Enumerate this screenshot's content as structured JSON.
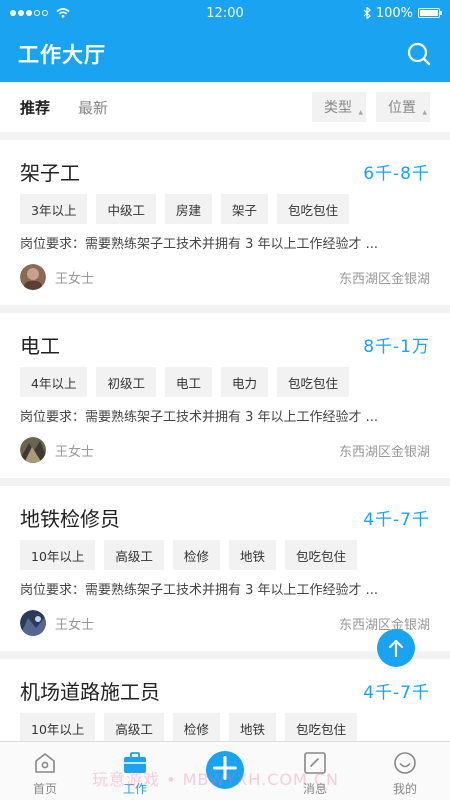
{
  "status_bar": {
    "time": "12:00",
    "battery": "100%"
  },
  "header": {
    "title": "工作大厅"
  },
  "filter_bar": {
    "tabs": [
      {
        "label": "推荐"
      },
      {
        "label": "最新"
      }
    ],
    "filters": [
      {
        "label": "类型"
      },
      {
        "label": "位置"
      }
    ]
  },
  "jobs": [
    {
      "title": "架子工",
      "salary": "6千-8千",
      "tags": [
        "3年以上",
        "中级工",
        "房建",
        "架子",
        "包吃包住"
      ],
      "requirement": "岗位要求：需要熟练架子工技术并拥有 3 年以上工作经验才 ...",
      "poster": "王女士",
      "location": "东西湖区金银湖"
    },
    {
      "title": "电工",
      "salary": "8千-1万",
      "tags": [
        "4年以上",
        "初级工",
        "电工",
        "电力",
        "包吃包住"
      ],
      "requirement": "岗位要求：需要熟练架子工技术并拥有 3 年以上工作经验才 ...",
      "poster": "王女士",
      "location": "东西湖区金银湖"
    },
    {
      "title": "地铁检修员",
      "salary": "4千-7千",
      "tags": [
        "10年以上",
        "高级工",
        "检修",
        "地铁",
        "包吃包住"
      ],
      "requirement": "岗位要求：需要熟练架子工技术并拥有 3 年以上工作经验才 ...",
      "poster": "王女士",
      "location": "东西湖区金银湖"
    },
    {
      "title": "机场道路施工员",
      "salary": "4千-7千",
      "tags": [
        "10年以上",
        "高级工",
        "检修",
        "地铁",
        "包吃包住"
      ]
    }
  ],
  "tabbar": {
    "items": [
      {
        "label": "首页"
      },
      {
        "label": "工作"
      },
      {
        "label": ""
      },
      {
        "label": "消息"
      },
      {
        "label": "我的"
      }
    ]
  },
  "watermark": "玩意游戏 • MBWYXH.COM.CN",
  "colors": {
    "accent": "#1aa3f0"
  }
}
